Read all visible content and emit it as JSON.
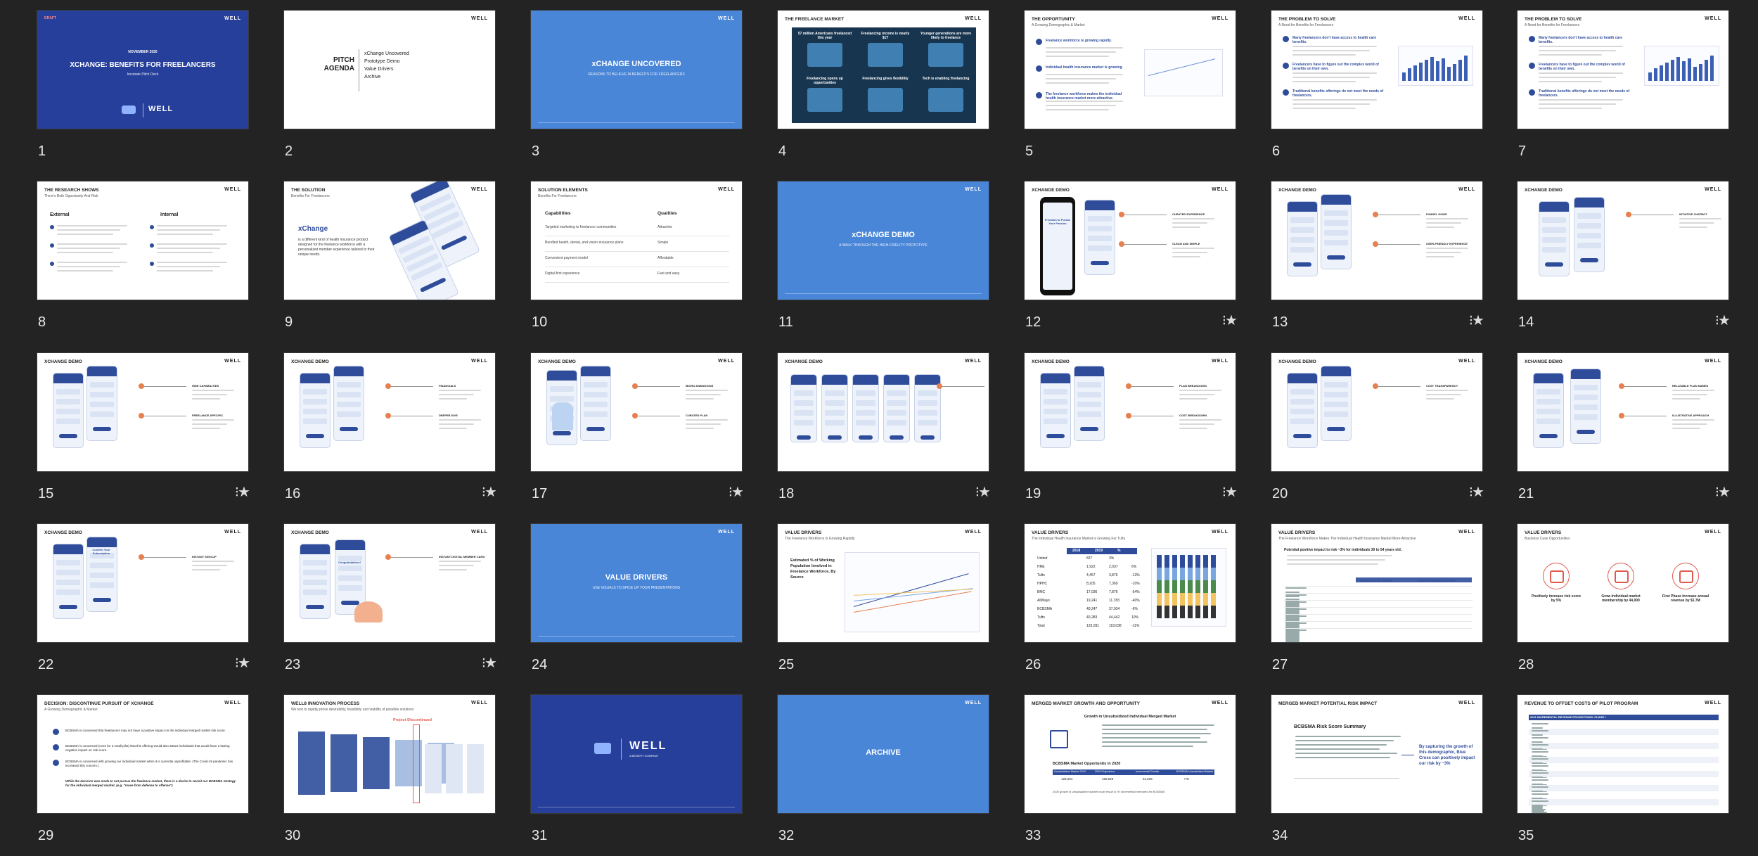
{
  "grid": {
    "slides": [
      {
        "n": "1",
        "star": false,
        "title": "XCHANGE: BENEFITS FOR FREELANCERS",
        "subtitle": "Incubate Pitch Deck",
        "date": "NOVEMBER 2020",
        "draft": "DRAFT",
        "logo": "WELL"
      },
      {
        "n": "2",
        "star": false,
        "title": "PITCH AGENDA",
        "agenda": [
          "xChange Uncovered",
          "Prototype Demo",
          "Value Drivers",
          "Archive"
        ],
        "logo": "WELL"
      },
      {
        "n": "3",
        "star": false,
        "title": "xCHANGE UNCOVERED",
        "subtitle": "REASONS TO BELIEVE IN BENEFITS FOR FREELANCERS",
        "logo": "WELL"
      },
      {
        "n": "4",
        "star": false,
        "title": "THE FREELANCE MARKET",
        "stats": [
          "57 million Americans freelanced this year",
          "Freelancing income is nearly $1T",
          "Younger generations are more likely to freelance",
          "Freelancing opens up opportunities",
          "Freelancing gives flexibility",
          "Tech is enabling freelancing"
        ],
        "logo": "WELL"
      },
      {
        "n": "5",
        "star": false,
        "title": "THE OPPORTUNITY",
        "subtitle": "A Growing Demographic & Market",
        "points": [
          "Freelance workforce is growing rapidly.",
          "Individual health insurance market is growing",
          "The freelance workforce makes the individual health insurance market more attractive."
        ],
        "logo": "WELL"
      },
      {
        "n": "6",
        "star": false,
        "title": "THE PROBLEM TO SOLVE",
        "subtitle": "A Need for Benefits for Freelancers",
        "points": [
          "Many freelancers don't have access to health care benefits.",
          "Freelancers have to figure out the complex world of benefits on their own.",
          "Traditional benefits offerings do not meet the needs of freelancers."
        ],
        "logo": "WELL"
      },
      {
        "n": "7",
        "star": false,
        "title": "THE PROBLEM TO SOLVE",
        "subtitle": "A Need for Benefits for Freelancers",
        "points": [
          "Many freelancers don't have access to health care benefits.",
          "Freelancers have to figure out the complex world of benefits on their own.",
          "Traditional benefits offerings do not meet the needs of freelancers."
        ],
        "logo": "WELL"
      },
      {
        "n": "8",
        "star": false,
        "title": "THE RESEARCH SHOWS",
        "subtitle": "There's Both Opportunity And Risk",
        "cols": [
          "External",
          "Internal"
        ],
        "logo": "WELL"
      },
      {
        "n": "9",
        "star": false,
        "title": "THE SOLUTION",
        "subtitle": "Benefits For Freelancers",
        "heading": "xChange",
        "body": "is a different kind of health insurance product designed for the freelance workforce with a personalized member experience tailored to their unique needs.",
        "logo": "WELL"
      },
      {
        "n": "10",
        "star": false,
        "title": "SOLUTION ELEMENTS",
        "subtitle": "Benefits For Freelancers",
        "cols": [
          "Capabilities",
          "Qualities"
        ],
        "capabilities": [
          "Targeted marketing to freelancer communities",
          "Bundled health, dental, and vision insurance plans",
          "Convenient payment model",
          "Digital-first experience"
        ],
        "qualities": [
          "Attractive",
          "Simple",
          "Affordable",
          "Fast and easy"
        ],
        "logo": "WELL"
      },
      {
        "n": "11",
        "star": false,
        "title": "xCHANGE DEMO",
        "subtitle": "A WALK THROUGH THE HIGH-FIDELITY PROTOTYPE",
        "logo": "WELL"
      },
      {
        "n": "12",
        "star": true,
        "title": "XCHANGE DEMO",
        "callouts": [
          "CURATED EXPERIENCE",
          "CLEAN AND SIMPLE"
        ],
        "phone_text": "Freedom to Pursue Your Passion",
        "logo": "WELL"
      },
      {
        "n": "13",
        "star": true,
        "title": "XCHANGE DEMO",
        "callouts": [
          "FUNNEL GUIDE",
          "USER-FRIENDLY EXPERIENCE"
        ],
        "logo": "WELL"
      },
      {
        "n": "14",
        "star": true,
        "title": "XCHANGE DEMO",
        "callouts": [
          "INTUITIVE CHATBOT"
        ],
        "logo": "WELL"
      },
      {
        "n": "15",
        "star": true,
        "title": "XCHANGE DEMO",
        "callouts": [
          "HIDE CAPABILITIES",
          "FREELANCE-SPECIFIC"
        ],
        "logo": "WELL"
      },
      {
        "n": "16",
        "star": true,
        "title": "XCHANGE DEMO",
        "callouts": [
          "FINANCIALS",
          "DEEPER DIVE"
        ],
        "logo": "WELL"
      },
      {
        "n": "17",
        "star": true,
        "title": "XCHANGE DEMO",
        "callouts": [
          "MICRO ANIMATIONS",
          "CURATED PLAN"
        ],
        "logo": "WELL"
      },
      {
        "n": "18",
        "star": true,
        "title": "XCHANGE DEMO",
        "callouts": [
          "PLAN PERKS"
        ],
        "logo": "WELL"
      },
      {
        "n": "19",
        "star": true,
        "title": "XCHANGE DEMO",
        "callouts": [
          "PLAN BREAKDOWN",
          "COST BREAKDOWN"
        ],
        "logo": "WELL"
      },
      {
        "n": "20",
        "star": true,
        "title": "XCHANGE DEMO",
        "callouts": [
          "COST TRANSPARENCY"
        ],
        "logo": "WELL"
      },
      {
        "n": "21",
        "star": true,
        "title": "XCHANGE DEMO",
        "callouts": [
          "RELATABLE PLAN NAMES",
          "ILLUSTRATIVE APPROACH"
        ],
        "logo": "WELL"
      },
      {
        "n": "22",
        "star": true,
        "title": "XCHANGE DEMO",
        "callouts": [
          "INSTANT SIGN-UP"
        ],
        "phone_text": "Confirm Your Subscription",
        "logo": "WELL"
      },
      {
        "n": "23",
        "star": true,
        "title": "XCHANGE DEMO",
        "callouts": [
          "INSTANT DIGITAL MEMBER CARD"
        ],
        "phone_text": "Congratulations!",
        "logo": "WELL"
      },
      {
        "n": "24",
        "star": false,
        "title": "VALUE DRIVERS",
        "subtitle": "USE VISUALS TO SPICE UP YOUR PRESENTATIONS",
        "logo": "WELL"
      },
      {
        "n": "25",
        "star": false,
        "title": "VALUE DRIVERS",
        "subtitle": "The Freelance Workforce is Growing Rapidly",
        "body": "Estimated % of Working Population Involved in Freelance Workforce, By Source",
        "logo": "WELL"
      },
      {
        "n": "26",
        "star": false,
        "title": "VALUE DRIVERS",
        "subtitle": "The Individual Health Insurance Market is Growing For Tufts",
        "table_head": [
          "2018",
          "2019",
          "%"
        ],
        "table_rows": [
          [
            "United",
            "827",
            "3%"
          ],
          [
            "HNE",
            "1,922",
            "2,037",
            "6%"
          ],
          [
            "Tufts",
            "4,457",
            "3,876",
            "-13%"
          ],
          [
            "HPHC",
            "8,205",
            "7,369",
            "-10%"
          ],
          [
            "BMC",
            "17,036",
            "7,876",
            "-54%"
          ],
          [
            "AllWays",
            "19,241",
            "11,783",
            "-40%"
          ],
          [
            "BCBSMA",
            "40,247",
            "37,934",
            "-6%"
          ],
          [
            "Tufts",
            "40,283",
            "44,442",
            "10%"
          ],
          [
            "Total",
            "133,091",
            "118,038",
            "-11%"
          ]
        ],
        "logo": "WELL"
      },
      {
        "n": "27",
        "star": false,
        "title": "VALUE DRIVERS",
        "subtitle": "The Freelance Workforce Makes The Individual Health Insurance Market More Attractive",
        "body": "Potential positive impact to risk ~3% for individuals 30 to 54 years old.",
        "table_labels": [
          "AVERAGE RISK SCORE",
          "AVERAGE MEMBER COUNT"
        ],
        "logo": "WELL"
      },
      {
        "n": "28",
        "star": false,
        "title": "VALUE DRIVERS",
        "subtitle": "Business Case Opportunities",
        "kpis": [
          "Positively increase risk score by 5%",
          "Grow individual market membership by 44,000",
          "First Phase increase annual revenue by $1.7M"
        ],
        "logo": "WELL"
      },
      {
        "n": "29",
        "star": false,
        "title": "DECISION: DISCONTINUE PURSUIT OF XCHANGE",
        "subtitle": "A Growing Demographic & Market",
        "points": [
          "BCBSMA is concerned that freelancers may not have a positive impact on the individual merged market risk score.",
          "BCBSMA is concerned (even for a small pilot) that this offering would also attract individuals that would have a lasting negative impact on risk score.",
          "BCBSMA is concerned with growing our individual market when it is currently unprofitable. (The Covid-19 pandemic has increased this concern.)"
        ],
        "note": "While the decision was made to not pursue the freelance market, there is a desire to revisit our BCBSMA strategy for the individual merged market. (e.g. \"move from defense to offense\")",
        "logo": "WELL"
      },
      {
        "n": "30",
        "star": false,
        "title": "WELL8 INNOVATION PROCESS",
        "subtitle": "We test to rapidly prove desirability, feasibility and viability of possible solutions",
        "badge": "Project Discontinued",
        "logo": "WELL"
      },
      {
        "n": "31",
        "star": false,
        "title": "WELL",
        "subtitle": "A BENEFIT COMPANY",
        "logo": "WELL"
      },
      {
        "n": "32",
        "star": false,
        "title": "ARCHIVE",
        "logo": "WELL"
      },
      {
        "n": "33",
        "star": false,
        "title": "MERGED MARKET GROWTH AND OPPORTUNITY",
        "heading": "Growth in Unsubsidized Individual Merged Market",
        "sub_heading": "BCBSMA Market Opportunity in 2020",
        "table_head": [
          "Unsubsidized Market 2019",
          "2020 Projections",
          "Incremental Growth",
          "BCBSMA Unsubsidized Market"
        ],
        "table_vals": [
          "128,004",
          "159,629",
          "31,625",
          "+7K"
        ],
        "note": "2020 growth in unsubsidized market could result in 7K incremental members for BCBSMA",
        "logo": "WELL"
      },
      {
        "n": "34",
        "star": false,
        "title": "MERGED MARKET POTENTIAL RISK IMPACT",
        "heading": "BCBSMA Risk Score Summary",
        "body": "By capturing the growth of this demographic, Blue Cross can positively impact our risk by ~3%",
        "logo": "WELL"
      },
      {
        "n": "35",
        "star": false,
        "title": "REVENUE TO OFFSET COSTS OF PILOT PROGRAM",
        "heading": "2021 INCREMENTAL REVENUE PROJECTIONS: PHASE I",
        "logo": "WELL"
      }
    ]
  },
  "colors": {
    "background": "#232323",
    "slide_blue": "#4a86d8",
    "slide_navy": "#263f9a",
    "accent": "#e7804f",
    "brand_navy": "#2e4c9a"
  },
  "icons": {
    "star": "star-icon",
    "slideshow": "play-slideshow-icon"
  }
}
